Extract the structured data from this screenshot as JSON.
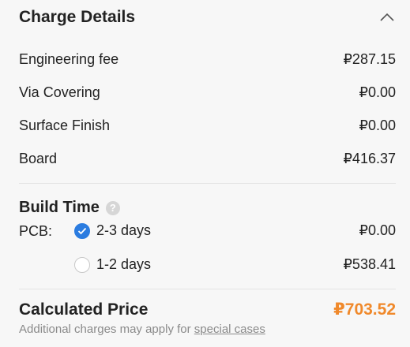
{
  "charge": {
    "title": "Charge Details",
    "items": [
      {
        "label": "Engineering fee",
        "value": "₽287.15"
      },
      {
        "label": "Via Covering",
        "value": "₽0.00"
      },
      {
        "label": "Surface Finish",
        "value": "₽0.00"
      },
      {
        "label": "Board",
        "value": "₽416.37"
      }
    ]
  },
  "build_time": {
    "title": "Build Time",
    "help_icon": "?",
    "pcb_label": "PCB:",
    "options": [
      {
        "label": "2-3 days",
        "value": "₽0.00",
        "selected": true
      },
      {
        "label": "1-2 days",
        "value": "₽538.41",
        "selected": false
      }
    ]
  },
  "calculated": {
    "label": "Calculated Price",
    "value": "₽703.52",
    "note_prefix": "Additional charges may apply for",
    "note_link": "special cases"
  },
  "colors": {
    "accent": "#2b7ce0",
    "price": "#f0892b"
  }
}
